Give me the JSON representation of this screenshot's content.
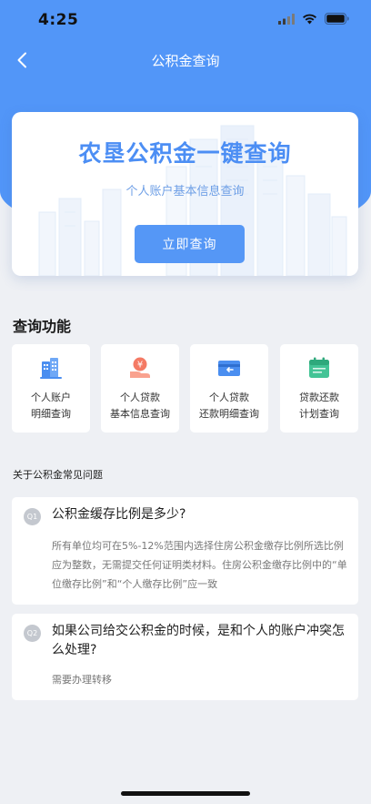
{
  "status_bar": {
    "time": "4:25",
    "icons": [
      "signal-icon",
      "wifi-icon",
      "battery-icon"
    ]
  },
  "nav": {
    "title": "公积金查询",
    "back_icon": "chevron-left-icon"
  },
  "hero": {
    "title": "农垦公积金一键查询",
    "subtitle": "个人账户基本信息查询",
    "button_label": "立即查询"
  },
  "functions": {
    "title": "查询功能",
    "items": [
      {
        "label": "个人账户\n明细查询",
        "icon": "buildings-icon",
        "color": "#4a8ef0"
      },
      {
        "label": "个人贷款\n基本信息查询",
        "icon": "yuan-hand-icon",
        "color": "#f47a64"
      },
      {
        "label": "个人贷款\n还款明细查询",
        "icon": "card-repay-icon",
        "color": "#4a8ef0"
      },
      {
        "label": "贷款还款\n计划查询",
        "icon": "calendar-icon",
        "color": "#44c496"
      }
    ]
  },
  "faq": {
    "heading": "关于公积金常见问题",
    "items": [
      {
        "badge": "Q1",
        "question": "公积金缓存比例是多少?",
        "answer": "所有单位均可在5%-12%范围内选择住房公积金缴存比例所选比例应为整数，无需提交任何证明类材料。住房公积金缴存比例中的“单位缴存比例”和“个人缴存比例”应一致"
      },
      {
        "badge": "Q2",
        "question": "如果公司给交公积金的时候，是和个人的账户冲突怎么处理?",
        "answer": "需要办理转移"
      }
    ]
  },
  "colors": {
    "primary": "#5296f8",
    "page_bg": "#eef0f4"
  }
}
